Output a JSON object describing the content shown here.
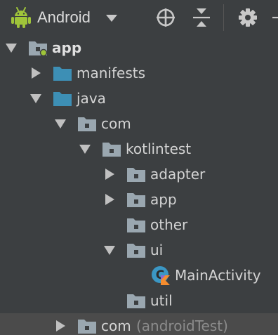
{
  "toolbar": {
    "view_mode": "Android",
    "buttons": [
      {
        "name": "locate",
        "icon": "crosshair-icon"
      },
      {
        "name": "collapse",
        "icon": "collapse-all-icon"
      },
      {
        "name": "settings",
        "icon": "gear-icon"
      }
    ]
  },
  "tree": {
    "nodes": [
      {
        "label": "app",
        "type": "module",
        "depth": 0,
        "expanded": true,
        "icon": "module-folder-icon"
      },
      {
        "label": "manifests",
        "type": "folder",
        "depth": 1,
        "expanded": false,
        "icon": "source-folder-icon"
      },
      {
        "label": "java",
        "type": "folder",
        "depth": 1,
        "expanded": true,
        "icon": "source-folder-icon"
      },
      {
        "label": "com",
        "type": "package",
        "depth": 2,
        "expanded": true,
        "icon": "package-icon"
      },
      {
        "label": "kotlintest",
        "type": "package",
        "depth": 3,
        "expanded": true,
        "icon": "package-icon"
      },
      {
        "label": "adapter",
        "type": "package",
        "depth": 4,
        "expanded": false,
        "icon": "package-icon"
      },
      {
        "label": "app",
        "type": "package",
        "depth": 4,
        "expanded": false,
        "icon": "package-icon"
      },
      {
        "label": "other",
        "type": "package",
        "depth": 4,
        "expanded": null,
        "icon": "package-icon"
      },
      {
        "label": "ui",
        "type": "package",
        "depth": 4,
        "expanded": true,
        "icon": "package-icon"
      },
      {
        "label": "MainActivity",
        "type": "kotlin-class",
        "depth": 5,
        "expanded": null,
        "icon": "kotlin-class-icon"
      },
      {
        "label": "util",
        "type": "package",
        "depth": 4,
        "expanded": null,
        "icon": "package-icon"
      },
      {
        "label": "com",
        "suffix": "(androidTest)",
        "type": "package",
        "depth": 2,
        "expanded": false,
        "icon": "package-icon",
        "selected": true
      }
    ]
  },
  "colors": {
    "background": "#3c3f41",
    "text": "#d4d4d4",
    "android_green": "#9fc43a",
    "folder_blue": "#3d8fb5",
    "folder_gray": "#9aa7b0",
    "kotlin_class_blue": "#3b97c4",
    "kotlin_orange": "#f58c2e",
    "selection": "#4b4b4b"
  }
}
